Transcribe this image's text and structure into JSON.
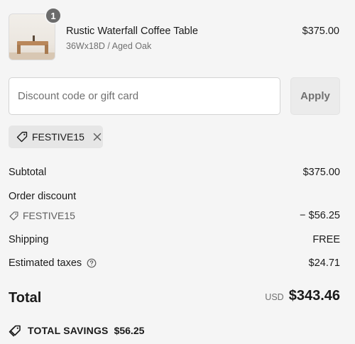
{
  "line_item": {
    "quantity": "1",
    "title": "Rustic Waterfall Coffee Table",
    "variant": "36Wx18D / Aged Oak",
    "price": "$375.00"
  },
  "discount": {
    "placeholder": "Discount code or gift card",
    "value": "",
    "apply_label": "Apply"
  },
  "applied_code": {
    "code": "FESTIVE15",
    "icon": "tag-icon",
    "remove_icon": "close-icon"
  },
  "summary": {
    "subtotal_label": "Subtotal",
    "subtotal_value": "$375.00",
    "order_discount_label": "Order discount",
    "discount_code": "FESTIVE15",
    "discount_value": "− $56.25",
    "shipping_label": "Shipping",
    "shipping_value": "FREE",
    "taxes_label": "Estimated taxes",
    "taxes_value": "$24.71"
  },
  "total": {
    "label": "Total",
    "currency": "USD",
    "amount": "$343.46"
  },
  "savings": {
    "label": "TOTAL SAVINGS",
    "amount": "$56.25"
  },
  "colors": {
    "background": "#f5f5f5",
    "text": "#1a1a1a",
    "muted": "#707070",
    "badge": "#6b6b6b"
  }
}
